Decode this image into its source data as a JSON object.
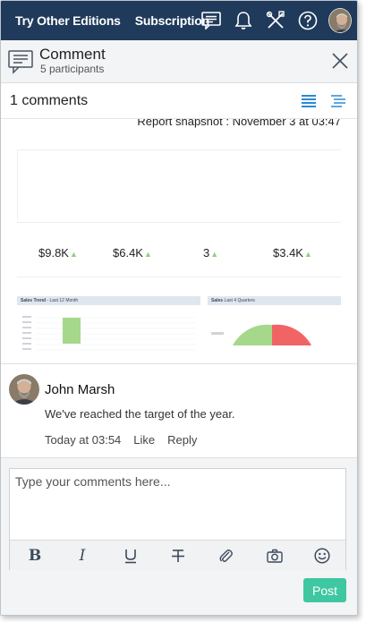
{
  "topbar": {
    "link_editions": "Try Other Editions",
    "link_subscription": "Subscription",
    "icons": [
      "feedback-icon",
      "bell-icon",
      "tools-icon",
      "help-icon",
      "avatar"
    ]
  },
  "panel": {
    "title": "Comment",
    "participants": "5 participants"
  },
  "comments_count": "1 comments",
  "snapshot": {
    "label": "Report snapshot : November 3 at 03:47",
    "kpis": [
      "$9.8K",
      "$6.4K",
      "3",
      "$3.4K"
    ],
    "charts": [
      {
        "title": "Sales Trend",
        "subtitle": "- Last 12 Month"
      },
      {
        "title": "Sales",
        "subtitle": "Last 4 Quarters"
      }
    ]
  },
  "comment": {
    "author": "John Marsh",
    "text": "We've reached the target of the year.",
    "time": "Today at 03:54",
    "like": "Like",
    "reply": "Reply"
  },
  "composer": {
    "placeholder": "Type your comments here...",
    "post_label": "Post",
    "tools": [
      "bold-icon",
      "italic-icon",
      "underline-icon",
      "strikethrough-icon",
      "attach-icon",
      "camera-icon",
      "emoji-icon"
    ]
  },
  "colors": {
    "topbar": "#1f3a5b",
    "accent_blue": "#2a8ad4",
    "post_green": "#3ec7a1",
    "kpi_up": "#8fd178",
    "gauge_green": "#a5d88b",
    "gauge_red": "#f16464"
  }
}
